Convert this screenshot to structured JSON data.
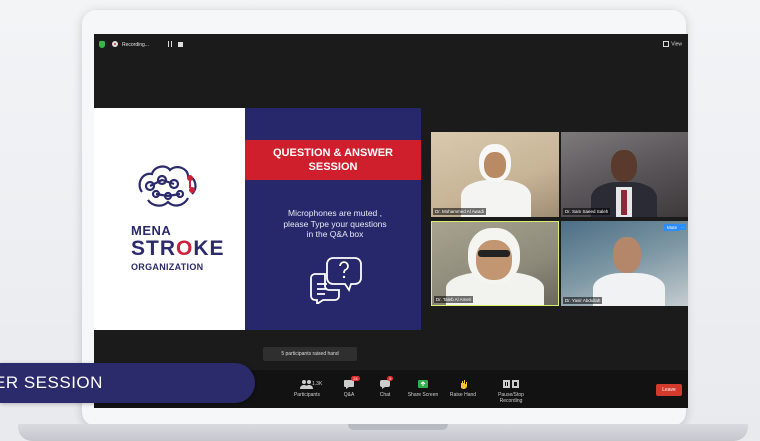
{
  "recording": {
    "label": "Recording..."
  },
  "view_button": {
    "label": "View"
  },
  "slide": {
    "logo": {
      "line1": "MENA",
      "line2_pre": "STR",
      "line2_o": "O",
      "line2_post": "KE",
      "line3": "ORGANIZATION"
    },
    "banner_line1": "QUESTION & ANSWER",
    "banner_line2": "SESSION",
    "message_line1": "Microphones are muted ,",
    "message_line2": "please Type your questions",
    "message_line3": "in the Q&A box"
  },
  "participants_video": [
    {
      "name": "Dr. Mohammed Al Awadi",
      "muted_label": ""
    },
    {
      "name": "Dr. Sam Saeed Saleh",
      "muted_label": ""
    },
    {
      "name": "Dr. Taleb Al Ameri",
      "muted_label": ""
    },
    {
      "name": "Dr. Yasir Abdullah",
      "muted_label": "Mute"
    }
  ],
  "toast": {
    "text": "5 participants raised hand"
  },
  "toolbar": {
    "participants": {
      "label": "Participants",
      "count": "1.3K"
    },
    "qa": {
      "label": "Q&A",
      "badge": "24"
    },
    "chat": {
      "label": "Chat",
      "badge": "5"
    },
    "share": {
      "label": "Share Screen"
    },
    "raise": {
      "label": "Raise Hand"
    },
    "pause": {
      "label": "Pause/Stop Recording"
    },
    "leave": {
      "label": "Leave"
    }
  },
  "caption": {
    "text": "ER SESSION"
  },
  "colors": {
    "brand_navy": "#2b2a6b",
    "brand_red": "#d01f2c",
    "zoom_blue": "#2d8cff",
    "leave_red": "#d33a2c"
  }
}
